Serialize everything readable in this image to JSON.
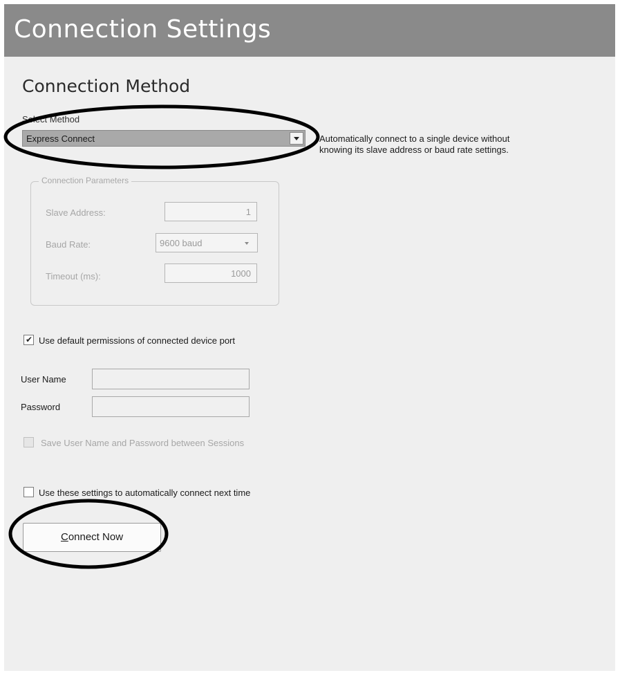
{
  "window": {
    "title": "Connection Settings"
  },
  "section": {
    "title": "Connection Method"
  },
  "method": {
    "label": "Select Method",
    "selected": "Express Connect",
    "description_line1": "Automatically connect to a single device without",
    "description_line2": "knowing its slave address or baud rate settings."
  },
  "params": {
    "legend": "Connection Parameters",
    "slave_label": "Slave Address:",
    "slave_value": "1",
    "baud_label": "Baud Rate:",
    "baud_value": "9600 baud",
    "timeout_label": "Timeout (ms):",
    "timeout_value": "1000"
  },
  "permissions": {
    "label": "Use default permissions of connected device port",
    "checked": true
  },
  "credentials": {
    "user_label": "User Name",
    "user_value": "",
    "password_label": "Password",
    "password_value": "",
    "save_label": "Save User Name and Password between Sessions"
  },
  "auto_connect": {
    "label": "Use these settings to automatically connect next time",
    "checked": false
  },
  "connect": {
    "mnemonic": "C",
    "label_rest": "onnect Now"
  },
  "colors": {
    "title_bar": "#8a8a8a",
    "panel": "#efefef",
    "select_highlight": "#a9a9a9",
    "annotation": "#000000"
  },
  "icons": [
    "chevron-down-icon",
    "checkmark-icon"
  ]
}
